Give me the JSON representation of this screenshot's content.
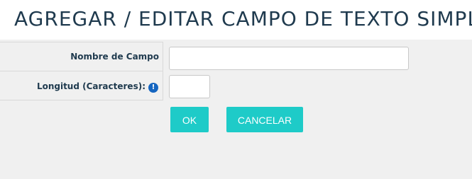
{
  "header": {
    "title": "AGREGAR / EDITAR CAMPO DE TEXTO SIMPLE"
  },
  "form": {
    "field_name": {
      "label": "Nombre de Campo",
      "value": ""
    },
    "length": {
      "label": "Longitud (Caracteres):",
      "value": "",
      "info_icon": "info-icon",
      "info_glyph": "!"
    }
  },
  "actions": {
    "ok_label": "OK",
    "cancel_label": "CANCELAR"
  },
  "colors": {
    "title": "#1f3a4e",
    "panel_bg": "#f0f0f0",
    "button_bg": "#1ecbc8",
    "info_icon": "#1565c0"
  }
}
